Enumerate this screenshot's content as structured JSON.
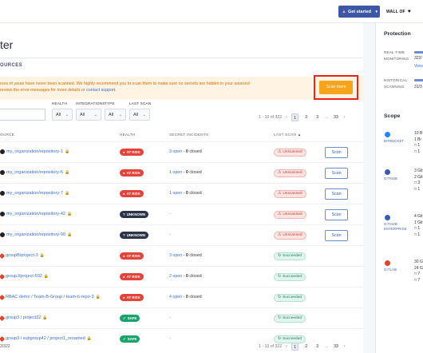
{
  "topbar": {
    "get_started": "Get started",
    "wall_of": "WALL OF"
  },
  "page": {
    "title": "ter"
  },
  "sources": {
    "header": "OURCES",
    "warning_line1": "rces of yours have never been scanned. We highly recommend you to scan them to make sure no secrets are hidden in your sources!",
    "warning_line2_pre": "review the error messages for more details or ",
    "warning_line2_link": "contact support",
    "warning_line2_post": ".",
    "scan_them": "Scan them"
  },
  "filters": {
    "health_label": "HEALTH",
    "integrations_label": "INTEGRATIONS",
    "type_label": "TYPE",
    "last_scan_label": "LAST SCAN",
    "health_value": "All",
    "integrations_value": "All",
    "type_value": "All",
    "last_scan_value": "All"
  },
  "pagination_top": {
    "range": "1 - 10 of 322",
    "p1": "1",
    "p2": "2",
    "p3": "3",
    "ellipsis": "...",
    "last": "33"
  },
  "pagination_bottom": {
    "range": "1 - 10 of 322",
    "p1": "1",
    "p2": "2",
    "p3": "3",
    "ellipsis": "...",
    "last": "33"
  },
  "table": {
    "headers": {
      "source": "OURCE",
      "health": "HEALTH",
      "incidents": "SECRET INCIDENTS",
      "last_scan": "LAST SCAN"
    },
    "rows": [
      {
        "icon": "github-icon",
        "name": "my_organization/repository-1",
        "health": "AT RISK",
        "health_kind": "risk",
        "open": "3 open",
        "sep": " - ",
        "closed": "0",
        "closed_label": " closed",
        "scan": "Unscanned",
        "scan_kind": "unscanned",
        "button": "Scan"
      },
      {
        "icon": "github-icon",
        "name": "my_organization/repository-6",
        "health": "AT RISK",
        "health_kind": "risk",
        "open": "1 open",
        "sep": " - ",
        "closed": "0",
        "closed_label": " closed",
        "scan": "Unscanned",
        "scan_kind": "unscanned",
        "button": "Scan"
      },
      {
        "icon": "github-icon",
        "name": "my_organization/repository-7",
        "health": "AT RISK",
        "health_kind": "risk",
        "open": "1 open",
        "sep": " - ",
        "closed": "0",
        "closed_label": " closed",
        "scan": "Unscanned",
        "scan_kind": "unscanned",
        "button": "Scan"
      },
      {
        "icon": "github-icon",
        "name": "my_organization/repository-42",
        "health": "UNKNOWN",
        "health_kind": "unknown",
        "open": "-",
        "sep": "",
        "closed": "",
        "closed_label": "",
        "scan": "Unscanned",
        "scan_kind": "unscanned",
        "button": "Scan"
      },
      {
        "icon": "github-icon",
        "name": "my_organization/repository-90",
        "health": "UNKNOWN",
        "health_kind": "unknown",
        "open": "-",
        "sep": "",
        "closed": "",
        "closed_label": "",
        "scan": "Unscanned",
        "scan_kind": "unscanned",
        "button": "Scan"
      },
      {
        "icon": "gitlab-icon",
        "name": "groupB/project-3",
        "health": "AT RISK",
        "health_kind": "risk",
        "open": "3 open",
        "sep": " - ",
        "closed": "0",
        "closed_label": " closed",
        "scan": "Succeeded",
        "scan_kind": "succeeded",
        "button": ""
      },
      {
        "icon": "gitlab-icon",
        "name": "groupJ/project-502",
        "health": "AT RISK",
        "health_kind": "risk",
        "open": "2 open",
        "sep": " - ",
        "closed": "0",
        "closed_label": " closed",
        "scan": "Succeeded",
        "scan_kind": "succeeded",
        "button": ""
      },
      {
        "icon": "gitlab-icon",
        "name": "RBAC demo / Team-B-Group / team-b-repo-3",
        "health": "AT RISK",
        "health_kind": "risk",
        "open": "4 open",
        "sep": " - ",
        "closed": "0",
        "closed_label": " closed",
        "scan": "Succeeded",
        "scan_kind": "succeeded",
        "button": ""
      },
      {
        "icon": "gitlab-icon",
        "name": "group3 / project32",
        "health": "SAFE",
        "health_kind": "safe",
        "open": "-",
        "sep": "",
        "closed": "",
        "closed_label": "",
        "scan": "Succeeded",
        "scan_kind": "succeeded",
        "button": ""
      },
      {
        "icon": "gitlab-icon",
        "name": "group3 / subgroup42 / project1_renamed",
        "health": "SAFE",
        "health_kind": "safe",
        "open": "-",
        "sep": "",
        "closed": "",
        "closed_label": "",
        "scan": "Succeeded",
        "scan_kind": "succeeded",
        "button": ""
      }
    ],
    "footer_count": "2/322"
  },
  "protection": {
    "title": "Protection",
    "realtime_label1": "REAL-TIME",
    "realtime_label2": "MONITORING",
    "realtime_value": "322/",
    "realtime_link": "View",
    "historical_label1": "HISTORICAL",
    "historical_label2": "SCANNING",
    "historical_value": "31/3"
  },
  "scope": {
    "title": "Scope",
    "items": [
      {
        "name1": "BITBUCKET",
        "name2": "",
        "l1": "10 B",
        "l2": "1 Bi",
        "l3": "□ 1",
        "l4": "□ 1"
      },
      {
        "name1": "GITHUB",
        "name2": "",
        "l1": "3 Git",
        "l2": "2 Git",
        "l3": "□ 3",
        "l4": "□ 1"
      },
      {
        "name1": "GITHUB",
        "name2": "ENTERPRISE",
        "l1": "4 Git",
        "l2": "1 Git",
        "l3": "□ 1",
        "l4": "□ 1"
      },
      {
        "name1": "GITLAB",
        "name2": "",
        "l1": "30 G",
        "l2": "24 G",
        "l3": "□ 7",
        "l4": "□ 7"
      }
    ]
  }
}
